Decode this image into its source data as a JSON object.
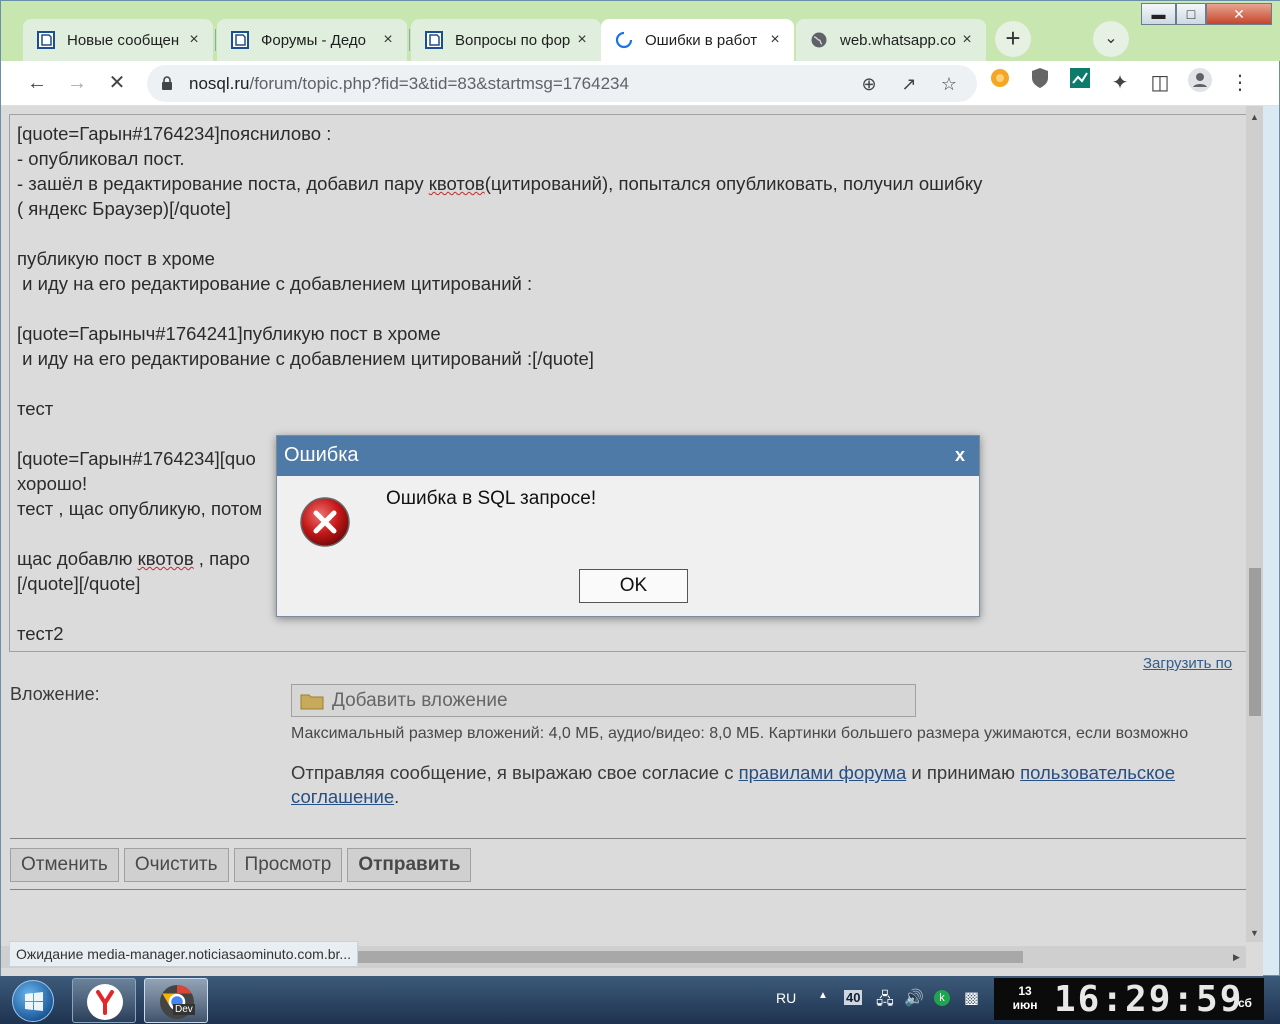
{
  "browser": {
    "tabs": [
      {
        "title": "Новые сообщен",
        "active": false
      },
      {
        "title": "Форумы - Дедо",
        "active": false
      },
      {
        "title": "Вопросы по фор",
        "active": false
      },
      {
        "title": "Ошибки в работ",
        "active": true
      },
      {
        "title": "web.whatsapp.co",
        "active": false
      }
    ],
    "tab_close": "×",
    "new_tab": "+",
    "tab_menu": "⌄",
    "url_host": "nosql.ru",
    "url_rest": "/forum/topic.php?fid=3&tid=83&startmsg=1764234",
    "status": "Ожидание media-manager.noticiasaominuto.com.br..."
  },
  "post": {
    "lines": [
      "[quote=Гарын#1764234]пояснилово :",
      "- опубликовал пост.",
      "- зашёл в редактирование поста, добавил пару квотов(цитирований), попытался опубликовать, получил ошибку",
      "( яндекс Браузер)[/quote]",
      "",
      "публикую пост в хроме",
      " и иду на его редактирование с добавлением цитирований :",
      "",
      "[quote=Гарыныч#1764241]публикую пост в хроме",
      " и иду на его редактирование с добавлением цитирований :[/quote]",
      "",
      "тест",
      "",
      "[quote=Гарын#1764234][quo",
      "хорошо!",
      "тест , щас опубликую, потом",
      "",
      "щас добавлю квотов , паро",
      "[/quote][/quote]",
      "",
      "тест2"
    ],
    "squiggle_word": "квотов"
  },
  "form": {
    "load_link": "Загрузить по",
    "attach_label": "Вложение:",
    "attach_button": "Добавить вложение",
    "max_size": "Максимальный размер вложений: 4,0 МБ, аудио/видео: 8,0 МБ. Картинки большего размера ужимаются, если возможно",
    "agree_prefix": "Отправляя сообщение, я выражаю свое согласие с ",
    "agree_link1": "правилами форума",
    "agree_middle": " и принимаю ",
    "agree_link2": "пользовательское соглашение",
    "agree_suffix": ".",
    "buttons": [
      "Отменить",
      "Очистить",
      "Просмотр",
      "Отправить"
    ]
  },
  "dialog": {
    "title": "Ошибка",
    "close": "x",
    "message": "Ошибка в SQL запросе!",
    "ok": "OK"
  },
  "taskbar": {
    "lang": "RU",
    "date_day": "13",
    "date_month": "июн",
    "time": "16:29:59",
    "weekday": "сб",
    "tray_number": "40",
    "chrome_label": "Dev"
  },
  "colors": {
    "dialog_header": "#4e7aa8",
    "link": "#2d5d9b",
    "tabstrip": "#c7e6b0"
  }
}
